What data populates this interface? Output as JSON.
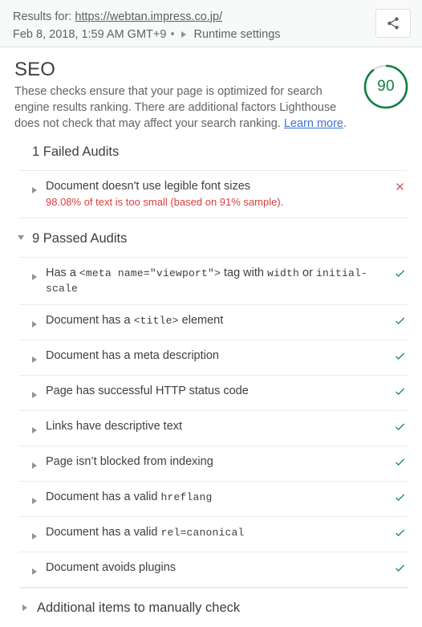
{
  "header": {
    "results_prefix": "Results for:",
    "url": "https://webtan.impress.co.jp/",
    "timestamp": "Feb 8, 2018, 1:59 AM GMT+9",
    "separator": "•",
    "runtime_settings_label": "Runtime settings",
    "share_icon": "share-icon"
  },
  "category": {
    "title": "SEO",
    "description": "These checks ensure that your page is optimized for search engine results ranking. There are additional factors Lighthouse does not check that may affect your search ranking.",
    "learn_more_label": "Learn more",
    "description_suffix": ".",
    "score": "90",
    "score_percent": 90,
    "score_color": "#0d8043",
    "score_track_color": "#dadce0"
  },
  "failed": {
    "section_title": "1 Failed Audits",
    "items": [
      {
        "title": "Document doesn't use legible font sizes",
        "detail": "98.08% of text is too small (based on 91% sample).",
        "status": "fail",
        "status_icon": "x-icon"
      }
    ]
  },
  "passed": {
    "section_title": "9 Passed Audits",
    "expanded": true,
    "items": [
      {
        "segments": [
          {
            "text": "Has a ",
            "mono": false
          },
          {
            "text": "<meta name=\"viewport\">",
            "mono": true
          },
          {
            "text": " tag with ",
            "mono": false
          },
          {
            "text": "width",
            "mono": true
          },
          {
            "text": " or ",
            "mono": false
          },
          {
            "text": "initial-scale",
            "mono": true
          }
        ],
        "status": "pass",
        "status_icon": "check-icon"
      },
      {
        "segments": [
          {
            "text": "Document has a ",
            "mono": false
          },
          {
            "text": "<title>",
            "mono": true
          },
          {
            "text": " element",
            "mono": false
          }
        ],
        "status": "pass",
        "status_icon": "check-icon"
      },
      {
        "segments": [
          {
            "text": "Document has a meta description",
            "mono": false
          }
        ],
        "status": "pass",
        "status_icon": "check-icon"
      },
      {
        "segments": [
          {
            "text": "Page has successful HTTP status code",
            "mono": false
          }
        ],
        "status": "pass",
        "status_icon": "check-icon"
      },
      {
        "segments": [
          {
            "text": "Links have descriptive text",
            "mono": false
          }
        ],
        "status": "pass",
        "status_icon": "check-icon"
      },
      {
        "segments": [
          {
            "text": "Page isn’t blocked from indexing",
            "mono": false
          }
        ],
        "status": "pass",
        "status_icon": "check-icon"
      },
      {
        "segments": [
          {
            "text": "Document has a valid ",
            "mono": false
          },
          {
            "text": "hreflang",
            "mono": true
          }
        ],
        "status": "pass",
        "status_icon": "check-icon"
      },
      {
        "segments": [
          {
            "text": "Document has a valid ",
            "mono": false
          },
          {
            "text": "rel=canonical",
            "mono": true
          }
        ],
        "status": "pass",
        "status_icon": "check-icon"
      },
      {
        "segments": [
          {
            "text": "Document avoids plugins",
            "mono": false
          }
        ],
        "status": "pass",
        "status_icon": "check-icon"
      }
    ]
  },
  "manual": {
    "label": "Additional items to manually check"
  },
  "colors": {
    "pass": "#0d8043",
    "fail": "#d93f3f",
    "link": "#3f73d4",
    "marker": "#879a87"
  }
}
